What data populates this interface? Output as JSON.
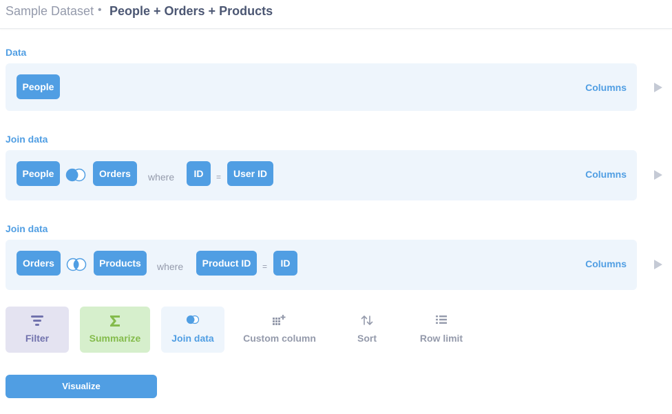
{
  "header": {
    "database": "Sample Dataset",
    "separator": "•",
    "title": "People + Orders + Products"
  },
  "data_step": {
    "label": "Data",
    "table": "People",
    "columns_label": "Columns"
  },
  "join_steps": [
    {
      "label": "Join data",
      "left_table": "People",
      "right_table": "Orders",
      "where_label": "where",
      "left_field": "ID",
      "operator": "=",
      "right_field": "User ID",
      "columns_label": "Columns"
    },
    {
      "label": "Join data",
      "left_table": "Orders",
      "right_table": "Products",
      "where_label": "where",
      "left_field": "Product ID",
      "operator": "=",
      "right_field": "ID",
      "columns_label": "Columns"
    }
  ],
  "actions": [
    {
      "label": "Filter",
      "icon": "filter-icon",
      "color": "#7172ad",
      "bg": "#e4e3f1"
    },
    {
      "label": "Summarize",
      "icon": "sigma-icon",
      "color": "#84bb4c",
      "bg": "#d6efcc"
    },
    {
      "label": "Join data",
      "icon": "join-icon",
      "color": "#509ee3",
      "bg": "#eef5fc"
    },
    {
      "label": "Custom column",
      "icon": "add-column-icon",
      "color": "#949aab",
      "bg": "transparent"
    },
    {
      "label": "Sort",
      "icon": "sort-icon",
      "color": "#949aab",
      "bg": "transparent"
    },
    {
      "label": "Row limit",
      "icon": "list-icon",
      "color": "#949aab",
      "bg": "transparent"
    }
  ],
  "visualize_label": "Visualize",
  "colors": {
    "brand": "#509ee3",
    "step_bg": "#eef5fc",
    "muted": "#949aab"
  }
}
